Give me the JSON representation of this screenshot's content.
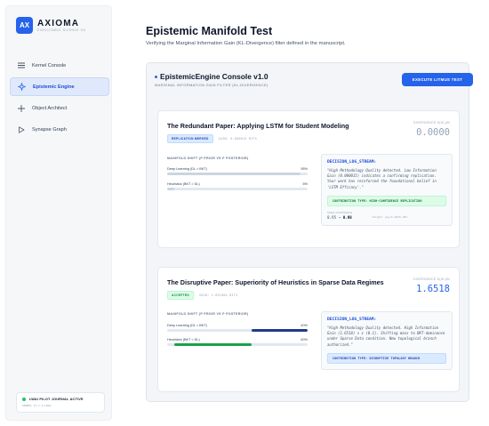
{
  "brand": {
    "logo": "AX",
    "name": "AXIOMA",
    "tagline": "EXECUTABLE SCIENCE OS"
  },
  "nav": {
    "items": [
      {
        "label": "Kernel Console",
        "icon": "menu-icon"
      },
      {
        "label": "Epistemic Engine",
        "icon": "sparkle-icon",
        "active": true
      },
      {
        "label": "Object Architect",
        "icon": "plus-icon"
      },
      {
        "label": "Synapse Graph",
        "icon": "play-icon"
      }
    ]
  },
  "journal": {
    "label": "LWAI PILOT JOURNAL ACTIVE",
    "version": "KERNEL V1.7.0-LWAI"
  },
  "page": {
    "title": "Epistemic Manifold Test",
    "subtitle": "Verifying the Marginal Information Gain (KL-Divergence) filter defined in the manuscript."
  },
  "console": {
    "title": "EpistemicEngine Console v1.0",
    "subtitle": "MARGINAL INFORMATION GAIN FILTER (KL-DIVERGENCE)",
    "execute_label": "EXECUTE LITMUS TEST"
  },
  "papers": [
    {
      "title": "The Redundant Paper: Applying LSTM for Student Modeling",
      "badge": "REPLICATION MERGED",
      "gain": "GAIN: 0.000015 BITS",
      "divergence_label": "DIVERGENCE D(KL)IN",
      "divergence_value": "0.0000",
      "shift_label": "MANIFOLD SHIFT (P PRIOR VS P POSTERIOR)",
      "bars": [
        {
          "label": "Deep Learning (DL > BKT)",
          "pct_label": "95%",
          "value": 0.95,
          "color": "#cbd5e1"
        },
        {
          "label": "Heuristics (BKT > DL)",
          "pct_label": "5%",
          "value": 0.05,
          "color": "#cbd5e1"
        }
      ],
      "log_title": "DECISION_LOG_STREAM:",
      "log_body": "\"High Methodology Quality detected. Low Information Gain (0.000015) indicates a confirming replication. Your work has reinforced the foundational belief in 'LSTM Efficacy'.\"",
      "contribution": "CONTRIBUTION TYPE: HIGH-CONFIDENCE REPLICATION",
      "conf_label": "NODE CONFIDENCE",
      "conf_from": "0.95",
      "conf_arrow": "→",
      "conf_to": "0.98",
      "target": "Target: psych-2015-dkt"
    },
    {
      "title": "The Disruptive Paper: Superiority of Heuristics in Sparse Data Regimes",
      "badge": "ACCEPTED",
      "gain": "GAIN: 1.651804 BITS",
      "divergence_label": "DIVERGENCE D(KL)IN",
      "divergence_value": "1.6518",
      "shift_label": "MANIFOLD SHIFT (P PRIOR VS P POSTERIOR)",
      "bars": [
        {
          "label": "Deep Learning (DL > BKT)",
          "pct_label": "40%",
          "value": 0.4,
          "color": "#1e3a8a"
        },
        {
          "label": "Heuristics (BKT > DL)",
          "pct_label": "60%",
          "value": 0.6,
          "color": "#16a34a"
        }
      ],
      "log_title": "DECISION_LOG_STREAM:",
      "log_body": "\"High Methodology Quality detected. High Information Gain (1.6518) > ε (0.1). Shifting mass to BKT-dominance under Sparse Data condition. New topological branch authorized.\"",
      "contribution": "CONTRIBUTION TYPE: DISRUPTIVE TOPOLOGY BRANCH"
    }
  ]
}
